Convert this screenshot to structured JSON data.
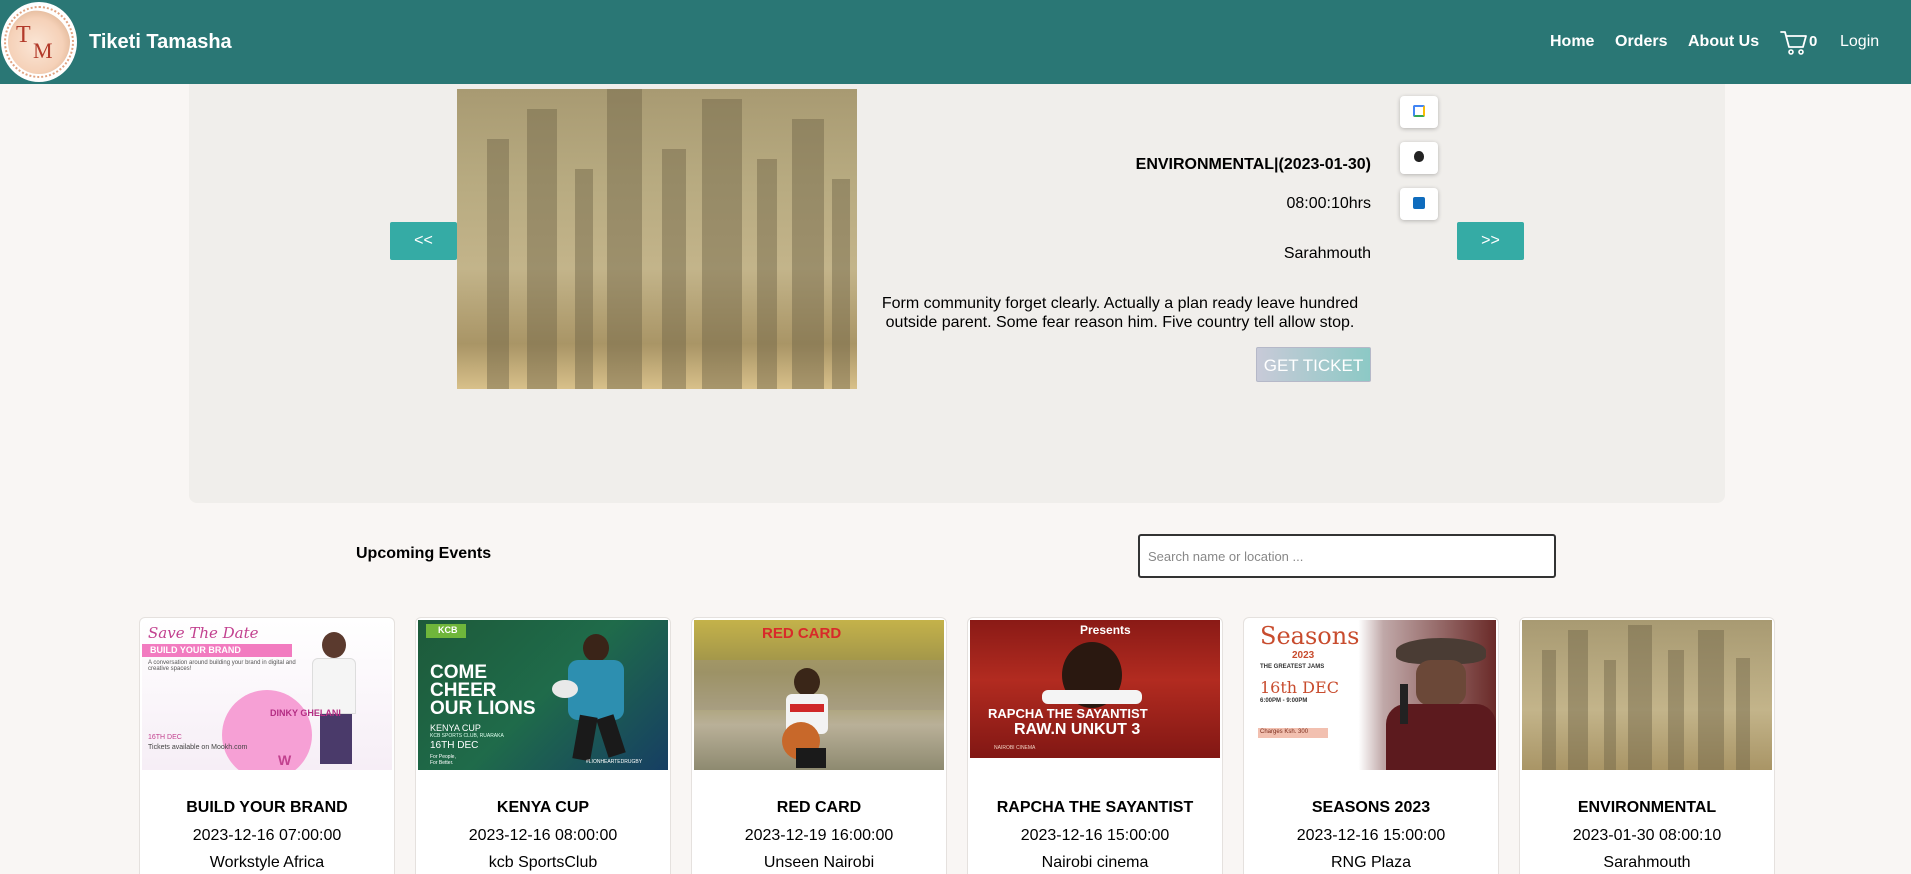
{
  "navbar": {
    "brand": "Tiketi Tamasha",
    "logo_t": "T",
    "logo_m": "M",
    "links": {
      "home": "Home",
      "orders": "Orders",
      "about": "About Us",
      "login": "Login"
    },
    "cart_count": "0"
  },
  "hero": {
    "prev_label": "<<",
    "next_label": ">>",
    "title": "ENVIRONMENTAL|(2023-01-30)",
    "time": "08:00:10hrs",
    "location": "Sarahmouth",
    "description": "Form community forget clearly. Actually a plan ready leave hundred outside parent. Some fear reason him. Five country tell allow stop.",
    "cta": "GET TICKET",
    "calendar_icons": [
      "google-calendar-icon",
      "apple-calendar-icon",
      "outlook-calendar-icon"
    ]
  },
  "upcoming": {
    "title": "Upcoming Events",
    "search_placeholder": "Search name or location ...",
    "cards": [
      {
        "name": "BUILD YOUR BRAND",
        "date": "2023-12-16 07:00:00",
        "location": "Workstyle Africa",
        "poster": {
          "script": "Save The Date",
          "banner": "BUILD YOUR BRAND",
          "tagline": "A conversation around building your brand in digital and creative spaces!",
          "host": "DINKY GHELANI",
          "date": "16TH DEC",
          "footer": "Tickets available on Mookh.com"
        }
      },
      {
        "name": "KENYA CUP",
        "date": "2023-12-16 08:00:00",
        "location": "kcb SportsClub",
        "poster": {
          "brand": "KCB",
          "headline_1": "COME",
          "headline_2": "CHEER",
          "headline_3": "OUR LIONS",
          "event": "KENYA CUP",
          "venue": "KCB SPORTS CLUB, RUARAKA",
          "date": "16TH DEC",
          "tag_1": "For People,",
          "tag_2": "For Better.",
          "hashtag": "#LIONHEARTEDRUGBY"
        }
      },
      {
        "name": "RED CARD",
        "date": "2023-12-19 16:00:00",
        "location": "Unseen Nairobi",
        "poster": {
          "title": "RED CARD"
        }
      },
      {
        "name": "RAPCHA THE SAYANTIST",
        "date": "2023-12-16 15:00:00",
        "location": "Nairobi cinema",
        "poster": {
          "presents": "Presents",
          "line_1": "RAPCHA THE SAYANTIST",
          "line_2": "RAW.N UNKUT 3",
          "venue": "NAIROBI CINEMA"
        }
      },
      {
        "name": "SEASONS 2023",
        "date": "2023-12-16 15:00:00",
        "location": "RNG Plaza",
        "poster": {
          "title": "Seasons",
          "year": "2023",
          "subtitle": "THE GREATEST JAMS",
          "date": "16th DEC",
          "time": "6:00PM - 9:00PM",
          "price": "Charges Ksh. 300"
        }
      },
      {
        "name": "ENVIRONMENTAL",
        "date": "2023-01-30 08:00:10",
        "location": "Sarahmouth",
        "poster": {}
      }
    ]
  },
  "colors": {
    "navbar": "#2a7775",
    "accent": "#35aba5",
    "page_bg": "#f9f6f4",
    "hero_bg": "#f0eeeb"
  }
}
